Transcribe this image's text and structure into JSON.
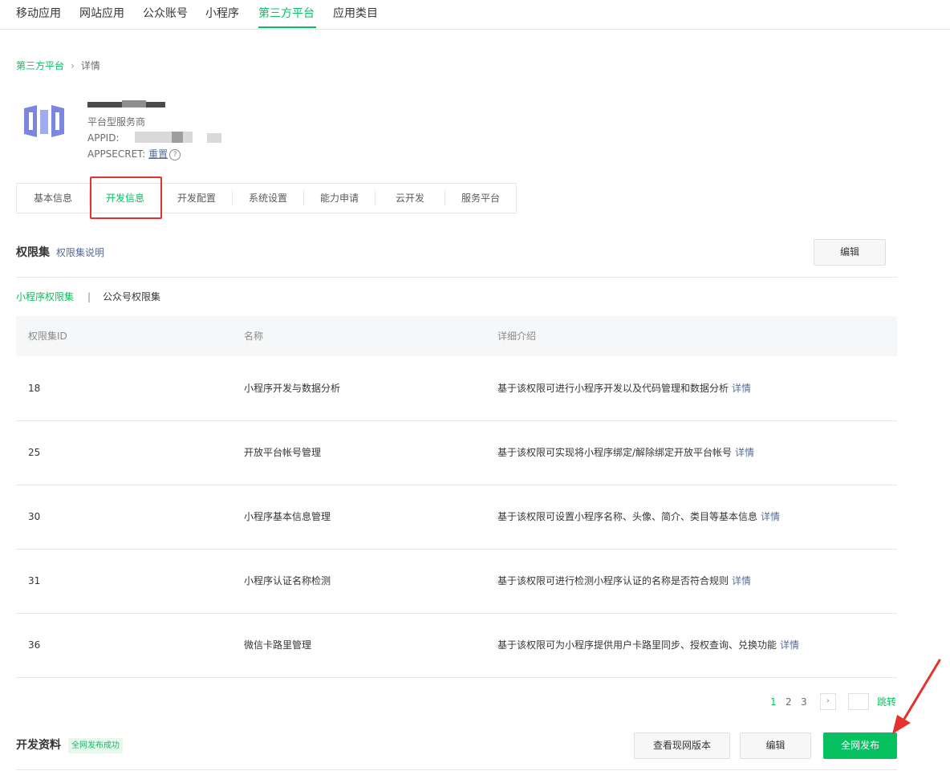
{
  "top_nav": {
    "items": [
      "移动应用",
      "网站应用",
      "公众账号",
      "小程序",
      "第三方平台",
      "应用类目"
    ],
    "active_index": 4
  },
  "breadcrumb": {
    "parent": "第三方平台",
    "separator": "›",
    "current": "详情"
  },
  "account": {
    "type": "平台型服务商",
    "appid_label": "APPID:",
    "appsecret_label": "APPSECRET:",
    "reset_link": "重置",
    "help_icon": "?"
  },
  "detail_tabs": {
    "items": [
      "基本信息",
      "开发信息",
      "开发配置",
      "系统设置",
      "能力申请",
      "云开发",
      "服务平台"
    ],
    "active_index": 1
  },
  "permissions": {
    "title": "权限集",
    "help_link": "权限集说明",
    "edit_button": "编辑",
    "subtabs": [
      "小程序权限集",
      "公众号权限集"
    ],
    "subtab_separator": "|",
    "columns": [
      "权限集ID",
      "名称",
      "详细介绍"
    ],
    "rows": [
      {
        "id": "18",
        "name": "小程序开发与数据分析",
        "desc": "基于该权限可进行小程序开发以及代码管理和数据分析",
        "link": "详情"
      },
      {
        "id": "25",
        "name": "开放平台帐号管理",
        "desc": "基于该权限可实现将小程序绑定/解除绑定开放平台帐号",
        "link": "详情"
      },
      {
        "id": "30",
        "name": "小程序基本信息管理",
        "desc": "基于该权限可设置小程序名称、头像、简介、类目等基本信息",
        "link": "详情"
      },
      {
        "id": "31",
        "name": "小程序认证名称检测",
        "desc": "基于该权限可进行检测小程序认证的名称是否符合规则",
        "link": "详情"
      },
      {
        "id": "36",
        "name": "微信卡路里管理",
        "desc": "基于该权限可为小程序提供用户卡路里同步、授权查询、兑换功能",
        "link": "详情"
      }
    ]
  },
  "pagination": {
    "pages": [
      "1",
      "2",
      "3"
    ],
    "current": "1",
    "next_icon": "›",
    "jump_label": "跳转"
  },
  "dev_materials": {
    "title": "开发资料",
    "status_badge": "全网发布成功",
    "view_button": "查看现网版本",
    "edit_button": "编辑",
    "publish_button": "全网发布"
  },
  "colors": {
    "accent": "#07c160",
    "link": "#576b95",
    "highlight_box": "#e5322d",
    "arrow": "#e5322d"
  }
}
